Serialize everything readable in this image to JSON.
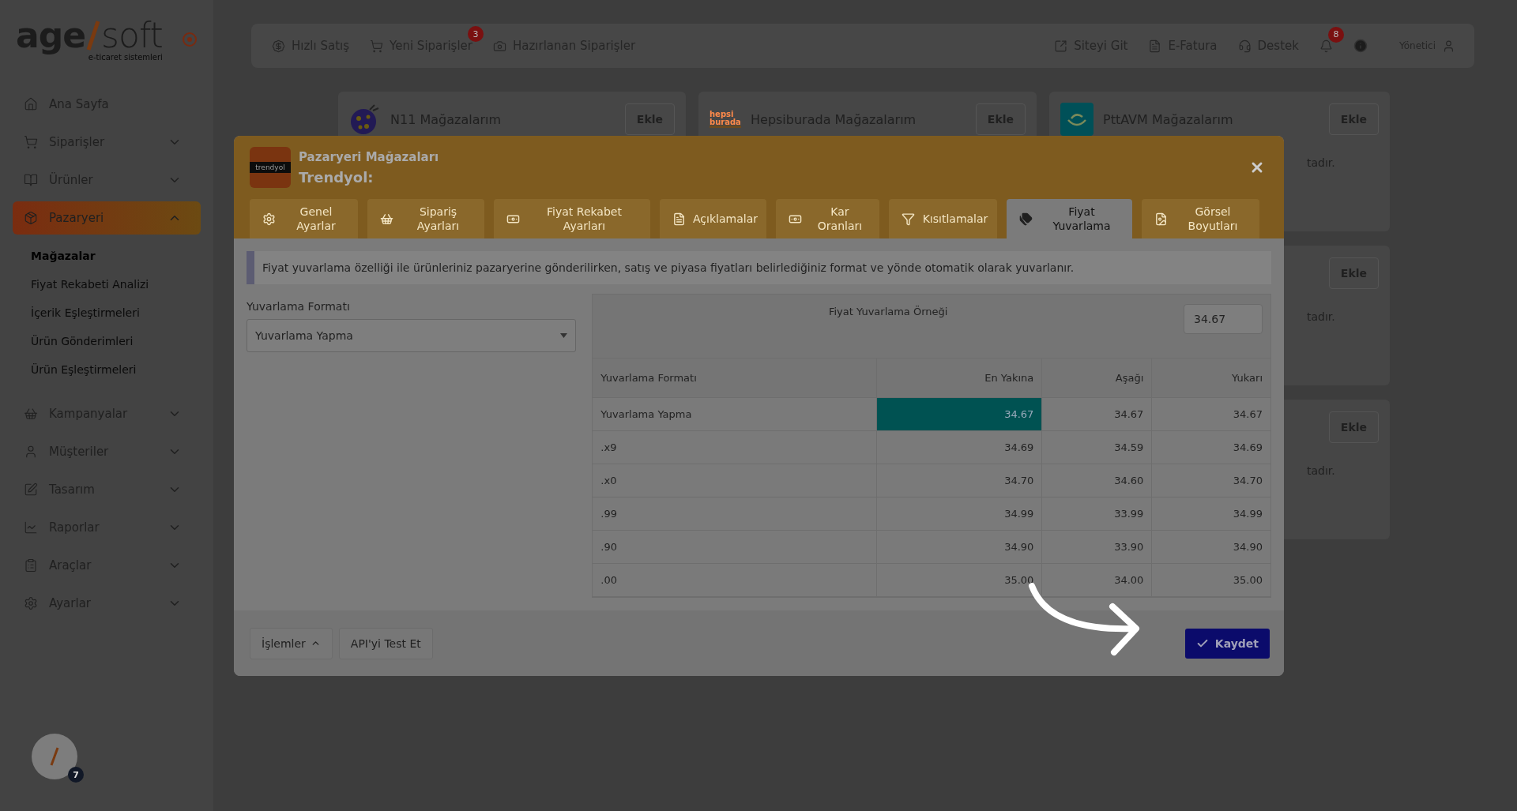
{
  "sidebar": {
    "logo": {
      "left": "age",
      "right": "soft",
      "tagline": "e-ticaret sistemleri"
    },
    "items": [
      {
        "label": "Ana Sayfa",
        "selected": false
      },
      {
        "label": "Siparişler",
        "selected": false,
        "expanded": false
      },
      {
        "label": "Ürünler",
        "selected": false,
        "expanded": false
      },
      {
        "label": "Pazaryeri",
        "selected": true,
        "expanded": true,
        "children": [
          {
            "label": "Mağazalar",
            "selected": true
          },
          {
            "label": "Fiyat Rekabeti Analizi",
            "selected": false
          },
          {
            "label": "İçerik Eşleştirmeleri",
            "selected": false
          },
          {
            "label": "Ürün Gönderimleri",
            "selected": false
          },
          {
            "label": "Ürün Eşleştirmeleri",
            "selected": false
          }
        ]
      },
      {
        "label": "Kampanyalar",
        "selected": false,
        "expanded": false
      },
      {
        "label": "Müşteriler",
        "selected": false,
        "expanded": false
      },
      {
        "label": "Tasarım",
        "selected": false,
        "expanded": false
      },
      {
        "label": "Raporlar",
        "selected": false,
        "expanded": false
      },
      {
        "label": "Araçlar",
        "selected": false,
        "expanded": false
      },
      {
        "label": "Ayarlar",
        "selected": false,
        "expanded": false
      }
    ]
  },
  "help_button": {
    "badge": "7"
  },
  "topbar": {
    "left": [
      {
        "label": "Hızlı Satış"
      },
      {
        "label": "Yeni Siparişler",
        "badge": "3"
      },
      {
        "label": "Hazırlanan Siparişler"
      }
    ],
    "right": [
      {
        "label": "Siteyi Git"
      },
      {
        "label": "E-Fatura"
      },
      {
        "label": "Destek"
      }
    ],
    "notifications": {
      "badge": "8"
    },
    "user": "Yönetici"
  },
  "store_columns": [
    {
      "cards": [
        {
          "kind": "n11",
          "title": "N11 Mağazalarım",
          "button": "Ekle"
        }
      ]
    },
    {
      "cards": [
        {
          "kind": "hepsiburada",
          "logo_text": "hepsi burada",
          "title": "Hepsiburada Mağazalarım",
          "button": "Ekle"
        }
      ]
    },
    {
      "cards": [
        {
          "kind": "pttavm",
          "title": "PttAVM Mağazalarım",
          "button": "Ekle",
          "note": "tadır."
        },
        {
          "button": "Ekle",
          "note": "tadır."
        },
        {
          "button": "Ekle",
          "note": "tadır."
        }
      ]
    }
  ],
  "modal": {
    "logo_text": "trendyol",
    "title": "Pazaryeri Mağazaları",
    "subtitle": "Trendyol:",
    "tabs": [
      {
        "label": "Genel\nAyarlar",
        "selected": false
      },
      {
        "label": "Sipariş\nAyarları",
        "selected": false
      },
      {
        "label": "Fiyat Rekabet\nAyarları",
        "selected": false
      },
      {
        "label": "Açıklamalar",
        "selected": false
      },
      {
        "label": "Kar\nOranları",
        "selected": false
      },
      {
        "label": "Kısıtlamalar",
        "selected": false
      },
      {
        "label": "Fiyat\nYuvarlama",
        "selected": true
      },
      {
        "label": "Görsel\nBoyutları",
        "selected": false
      }
    ],
    "info": "Fiyat yuvarlama özelliği ile ürünleriniz pazaryerine gönderilirken, satış ve piyasa fiyatları belirlediğiniz format ve yönde otomatik olarak yuvarlanır.",
    "format_label": "Yuvarlama Formatı",
    "format_value": "Yuvarlama Yapma",
    "example": {
      "title": "Fiyat Yuvarlama Örneği",
      "input": "34.67",
      "columns": [
        "Yuvarlama Formatı",
        "En Yakına",
        "Aşağı",
        "Yukarı"
      ],
      "rows": [
        {
          "cells": [
            {
              "text": "Yuvarlama Yapma",
              "selected": false
            },
            {
              "text": "34.67",
              "selected": true
            },
            {
              "text": "34.67",
              "selected": false
            },
            {
              "text": "34.67",
              "selected": false
            }
          ]
        },
        {
          "cells": [
            {
              "text": ".x9",
              "selected": false
            },
            {
              "text": "34.69",
              "selected": false
            },
            {
              "text": "34.59",
              "selected": false
            },
            {
              "text": "34.69",
              "selected": false
            }
          ]
        },
        {
          "cells": [
            {
              "text": ".x0",
              "selected": false
            },
            {
              "text": "34.70",
              "selected": false
            },
            {
              "text": "34.60",
              "selected": false
            },
            {
              "text": "34.70",
              "selected": false
            }
          ]
        },
        {
          "cells": [
            {
              "text": ".99",
              "selected": false
            },
            {
              "text": "34.99",
              "selected": false
            },
            {
              "text": "33.99",
              "selected": false
            },
            {
              "text": "34.99",
              "selected": false
            }
          ]
        },
        {
          "cells": [
            {
              "text": ".90",
              "selected": false
            },
            {
              "text": "34.90",
              "selected": false
            },
            {
              "text": "33.90",
              "selected": false
            },
            {
              "text": "34.90",
              "selected": false
            }
          ]
        },
        {
          "cells": [
            {
              "text": ".00",
              "selected": false
            },
            {
              "text": "35.00",
              "selected": false
            },
            {
              "text": "34.00",
              "selected": false
            },
            {
              "text": "35.00",
              "selected": false
            }
          ]
        }
      ]
    },
    "footer": {
      "actions": "İşlemler",
      "test": "API'yi Test Et",
      "save": "Kaydet"
    }
  }
}
